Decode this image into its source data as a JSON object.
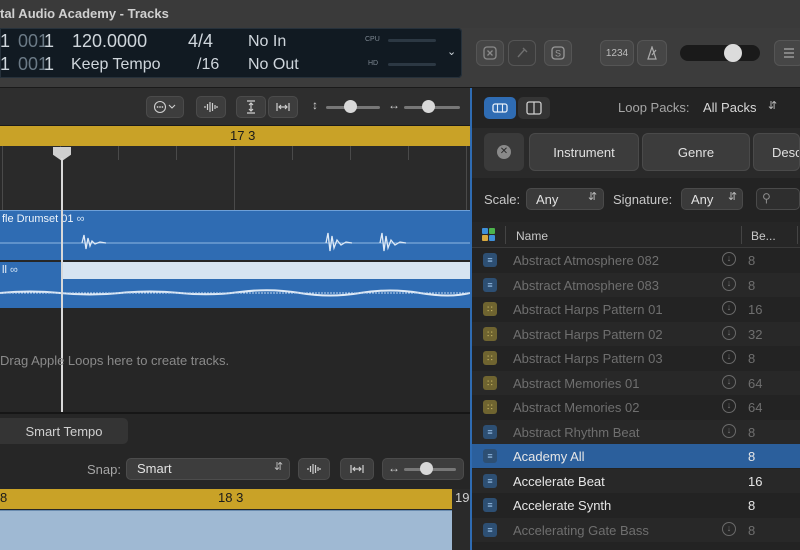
{
  "window": {
    "title": "tal Audio Academy - Tracks"
  },
  "lcd": {
    "pos_bar_top": "1",
    "pos_beat_top": "001",
    "pos_div_top": "1",
    "pos_bar_bottom": "1",
    "pos_beat_bottom": "001",
    "pos_div_bottom": "1",
    "tempo": "120.0000",
    "tempo_mode": "Keep Tempo",
    "time_sig": "4/4",
    "division": "/16",
    "key_in": "No In",
    "key_out": "No Out",
    "cpu_label": "CPU",
    "hd_label": "HD"
  },
  "controlbar": {
    "counter_label": "1234"
  },
  "tracks": {
    "ruler_marker": "17 3",
    "region1_name": "fle Drumset 01",
    "region2_name": "ll",
    "loop_symbol": "∞",
    "drag_hint": "Drag Apple Loops here to create tracks.",
    "smart_tempo": "Smart Tempo",
    "snap_label": "Snap:",
    "snap_value": "Smart",
    "ruler2_left": "8",
    "ruler2_mid": "18 3",
    "ruler2_right": "19"
  },
  "loop_browser": {
    "loop_packs_label": "Loop Packs:",
    "loop_packs_value": "All Packs",
    "filters": [
      "Instrument",
      "Genre",
      "Desc"
    ],
    "scale_label": "Scale:",
    "scale_value": "Any",
    "signature_label": "Signature:",
    "signature_value": "Any",
    "col_name": "Name",
    "col_beats": "Be...",
    "rows": [
      {
        "name": "Abstract Atmosphere 082",
        "beats": "8",
        "type": "audio",
        "state": "dim"
      },
      {
        "name": "Abstract Atmosphere 083",
        "beats": "8",
        "type": "audio",
        "state": "dim"
      },
      {
        "name": "Abstract Harps Pattern 01",
        "beats": "16",
        "type": "midi",
        "state": "dim"
      },
      {
        "name": "Abstract Harps Pattern 02",
        "beats": "32",
        "type": "midi",
        "state": "dim"
      },
      {
        "name": "Abstract Harps Pattern 03",
        "beats": "8",
        "type": "midi",
        "state": "dim"
      },
      {
        "name": "Abstract Memories 01",
        "beats": "64",
        "type": "midi",
        "state": "dim"
      },
      {
        "name": "Abstract Memories 02",
        "beats": "64",
        "type": "midi",
        "state": "dim"
      },
      {
        "name": "Abstract Rhythm Beat",
        "beats": "8",
        "type": "audio",
        "state": "dim"
      },
      {
        "name": "Academy All",
        "beats": "8",
        "type": "audio",
        "state": "selected"
      },
      {
        "name": "Accelerate Beat",
        "beats": "16",
        "type": "audio",
        "state": "lit"
      },
      {
        "name": "Accelerate Synth",
        "beats": "8",
        "type": "audio",
        "state": "lit"
      },
      {
        "name": "Accelerating Gate Bass",
        "beats": "8",
        "type": "audio",
        "state": "dim"
      }
    ]
  },
  "colors": {
    "accent_blue": "#2f6cb3",
    "ruler_yellow": "#c9a227",
    "region_blue": "#2f6cb3"
  }
}
